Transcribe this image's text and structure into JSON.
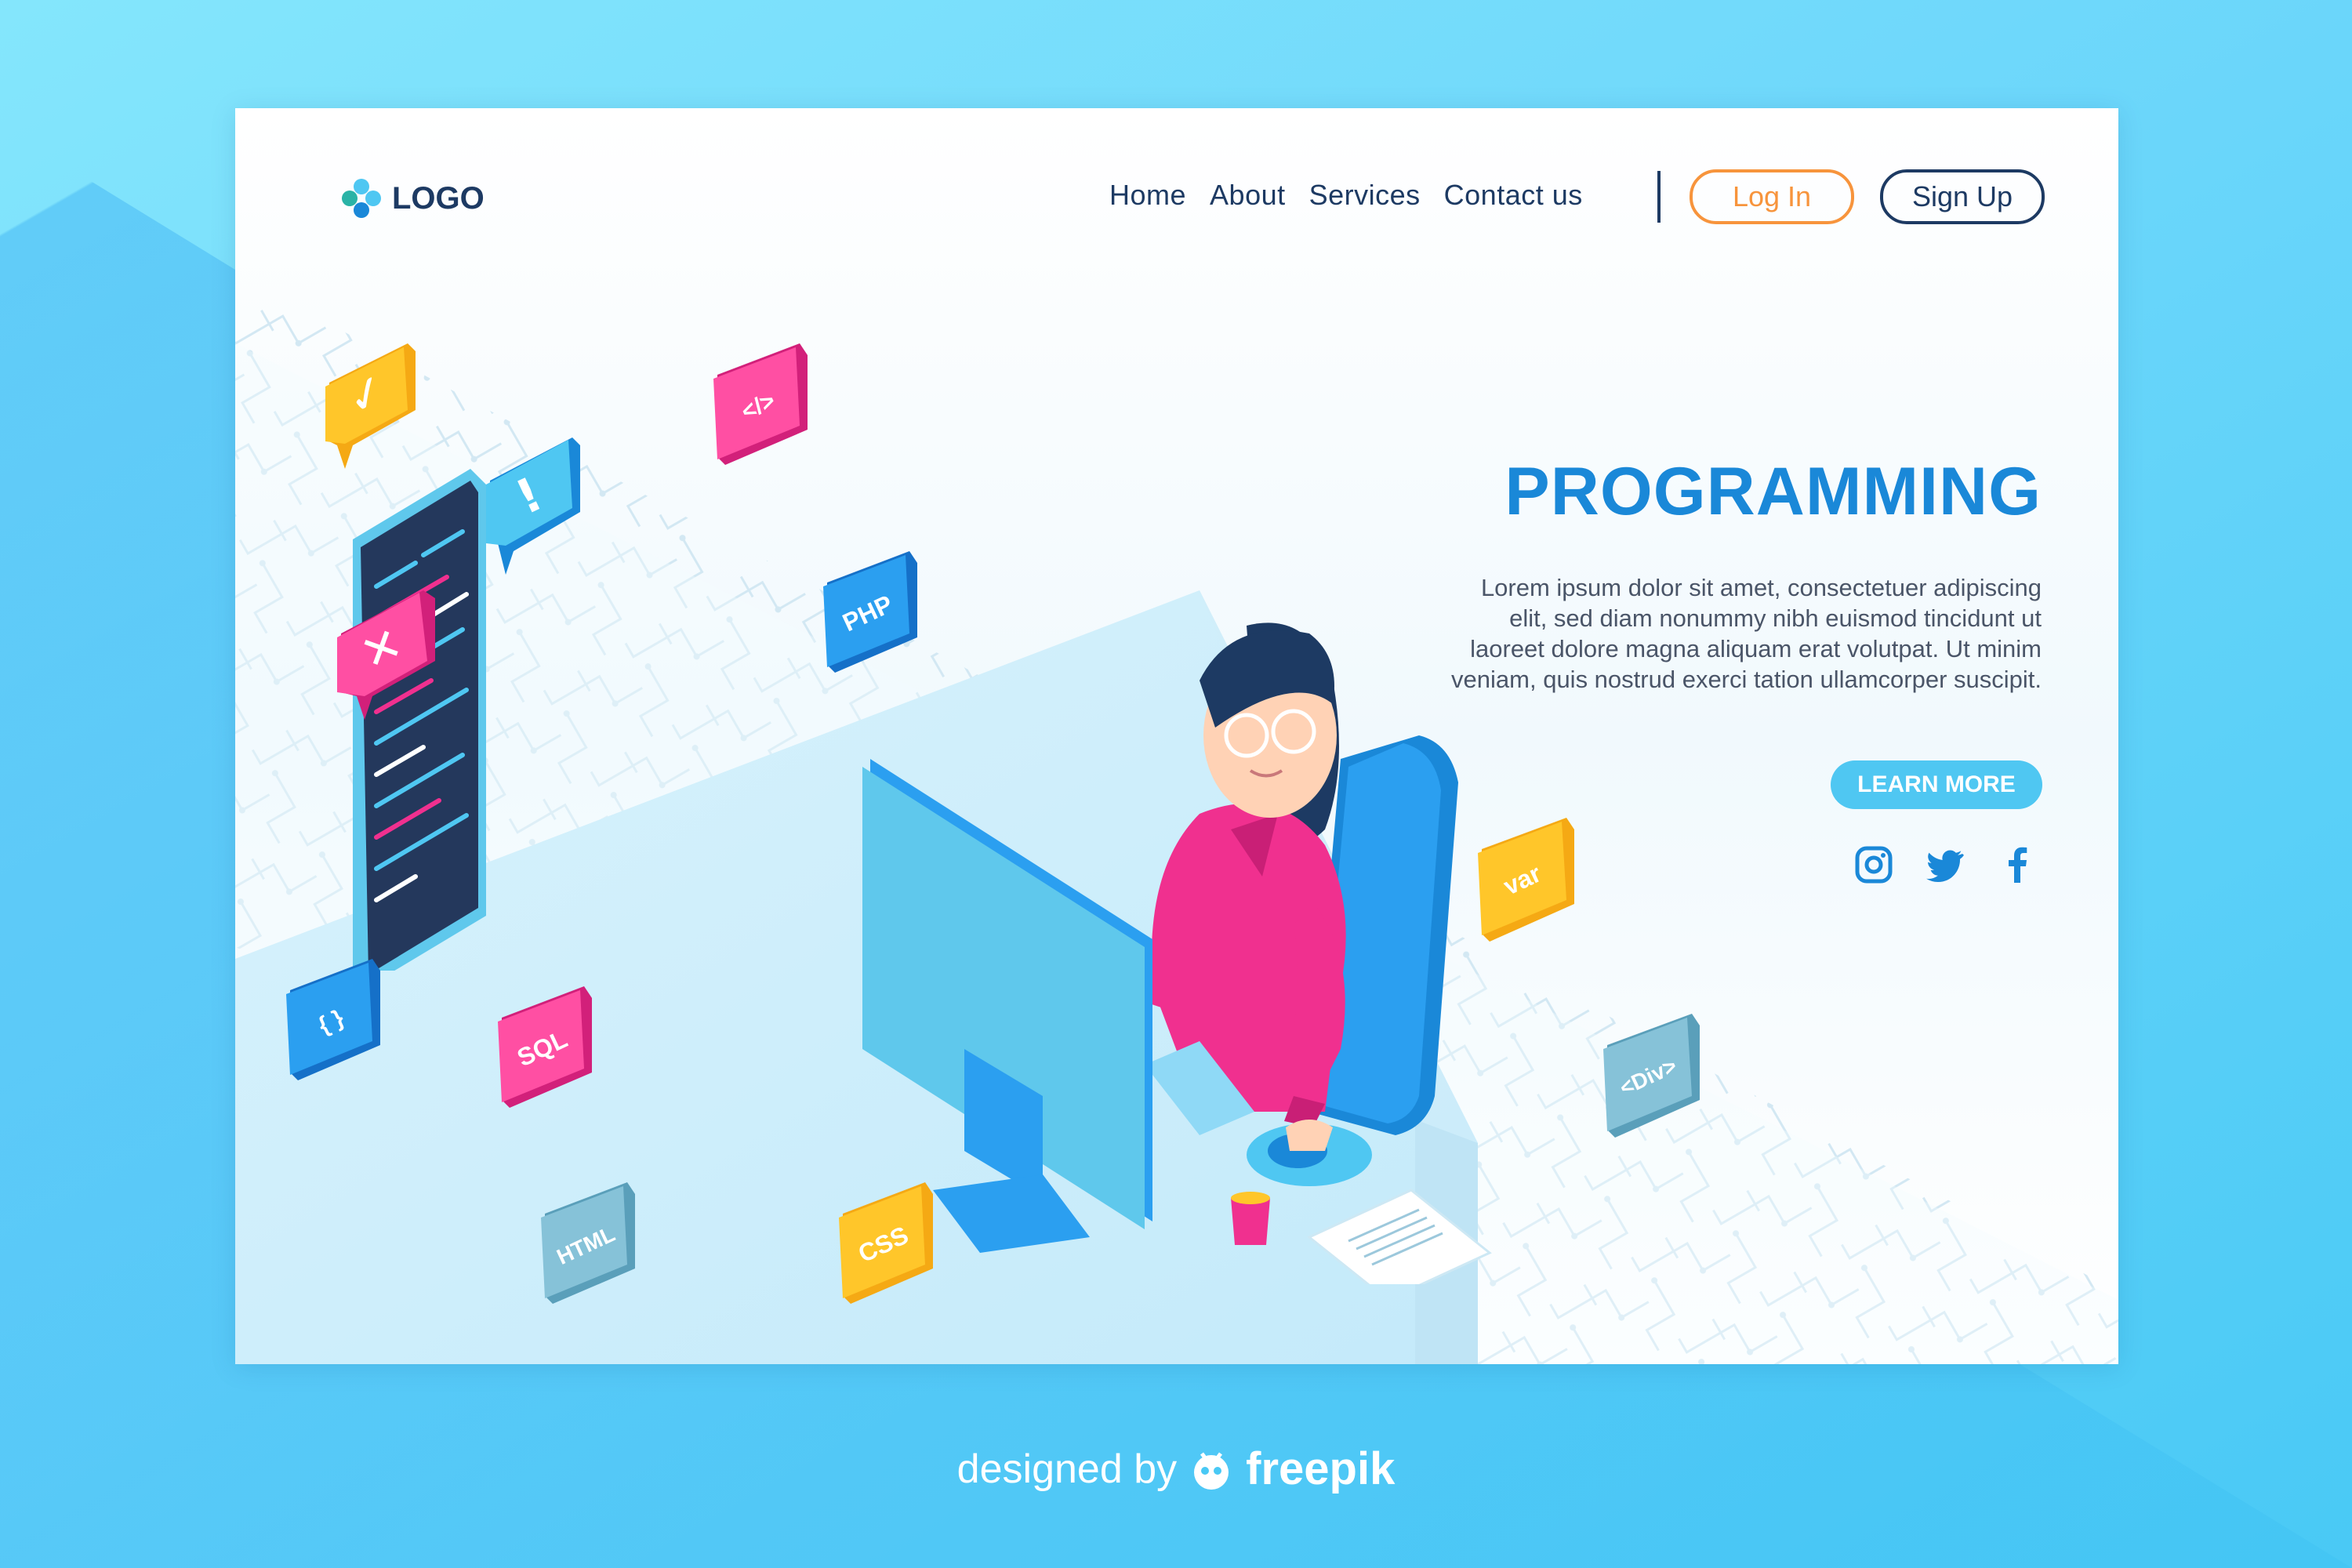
{
  "nav": {
    "logo_text": "LOGO",
    "links": [
      "Home",
      "About",
      "Services",
      "Contact us"
    ],
    "login_label": "Log In",
    "signup_label": "Sign Up"
  },
  "hero": {
    "title": "PROGRAMMING",
    "body": "Lorem ipsum dolor sit amet, consectetuer adipiscing elit, sed diam nonummy nibh euismod tincidunt ut laoreet dolore magna aliquam erat volutpat. Ut minim veniam, quis nostrud exerci tation ullamcorper suscipit.",
    "cta_label": "LEARN MORE"
  },
  "socials": [
    "instagram-icon",
    "twitter-icon",
    "facebook-icon"
  ],
  "code_tags": {
    "php": "PHP",
    "sql": "SQL",
    "html": "HTML",
    "css": "CSS",
    "var": "var",
    "div": "<Div>",
    "braces": "{ }",
    "tag": "</>"
  },
  "chat_bubbles": {
    "check": "✓",
    "alert": "!",
    "error": "✕"
  },
  "footer": {
    "prefix": "designed by",
    "brand": "freepik"
  },
  "colors": {
    "accent": "#1a88d8",
    "navy": "#1d3a63",
    "orange": "#f7943c",
    "pink": "#f0308f",
    "yellow": "#ffc62a",
    "blue": "#2b9ff0",
    "teal": "#7ab8d0"
  }
}
